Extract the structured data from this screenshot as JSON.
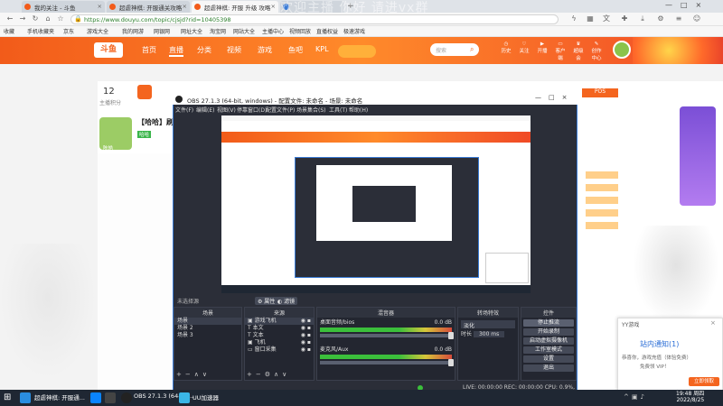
{
  "browser": {
    "tabs": [
      {
        "label": "我的关注 - 斗鱼",
        "active": false
      },
      {
        "label": "超虐神棋: 开服通关攻略",
        "active": false
      },
      {
        "label": "超虐神棋: 开服 升级 攻略",
        "active": true
      },
      {
        "label": "",
        "active": false
      }
    ],
    "url": "https://www.douyu.com/topic/cjsjd?rid=10405398",
    "bookmarks": [
      "收藏",
      "手机收藏夹",
      "京东",
      "游戏大全",
      "我的网游",
      "网银网",
      "网址大全",
      "淘宝网",
      "网站大全",
      "主播中心",
      "视频回放",
      "直播权益",
      "极速游戏"
    ]
  },
  "site": {
    "logo": "斗鱼",
    "nav": [
      {
        "label": "首页",
        "active": false
      },
      {
        "label": "直播",
        "active": true
      },
      {
        "label": "分类",
        "active": false
      },
      {
        "label": "视频",
        "active": false
      },
      {
        "label": "游戏",
        "active": false
      },
      {
        "label": "鱼吧",
        "active": false
      },
      {
        "label": "KPL",
        "active": false
      }
    ],
    "search_placeholder": "搜索",
    "header_icons": [
      "历史",
      "关注",
      "开播",
      "客户端",
      "超级会",
      "创作中心"
    ]
  },
  "room": {
    "follow_count": "12",
    "follow_label": "主播积分",
    "streamer_short": "陈皓",
    "streamer_name": "【哈哈】刷",
    "tag": "哈哈"
  },
  "obs": {
    "title": "OBS 27.1.3 (64-bit, windows) - 配置文件: 未命名 - 场景: 未命名",
    "menu": [
      "文件(F)",
      "编辑(E)",
      "视图(V)",
      "停靠窗口(D)",
      "配置文件(P)",
      "场景集合(S)",
      "工具(T)",
      "帮助(H)"
    ],
    "no_source_label": "未选择源",
    "props_button": "属性",
    "filters_button": "滤镜",
    "scenes_header": "场景",
    "scenes": [
      "场景",
      "场景 2",
      "场景 3"
    ],
    "sources_header": "来源",
    "sources": [
      "游戏飞机",
      "本文",
      "文本",
      "飞机",
      "窗口采集"
    ],
    "mixer_header": "混音器",
    "mixer_channels": [
      {
        "name": "桌面音频/bios",
        "level": "0.0 dB"
      },
      {
        "name": "麦克风/Aux",
        "level": "0.0 dB"
      }
    ],
    "transition_header": "转场特效",
    "transition_value": "淡化",
    "duration_label": "时长",
    "duration_value": "300 ms",
    "controls_header": "控件",
    "controls": [
      "停止推流",
      "开始录制",
      "启动虚拟摄像机",
      "工作室模式",
      "设置",
      "退出"
    ],
    "status": "LIVE: 00:00:00   REC: 00:00:00   CPU: 0.9%, 30.00 fps"
  },
  "notification": {
    "app": "YY游戏",
    "title": "站内通知(1)",
    "body_line1": "恭喜你，游戏充值（体验免费）",
    "body_line2": "免费领 VIP！",
    "button": "立即领取"
  },
  "overlay_text": "欢迎主播 你好 请进vx群",
  "taskbar": {
    "apps": [
      "超虐神棋: 开服通...",
      "OBS 27.1.3 (64-bit...",
      "UU加速器"
    ],
    "time": "19:48 周四",
    "date": "2022/8/25"
  },
  "colors": {
    "brand": "#f4651f",
    "obs_bg": "#2b2e38",
    "taskbar": "#1f2733",
    "accent_blue": "#3a7bd5"
  }
}
